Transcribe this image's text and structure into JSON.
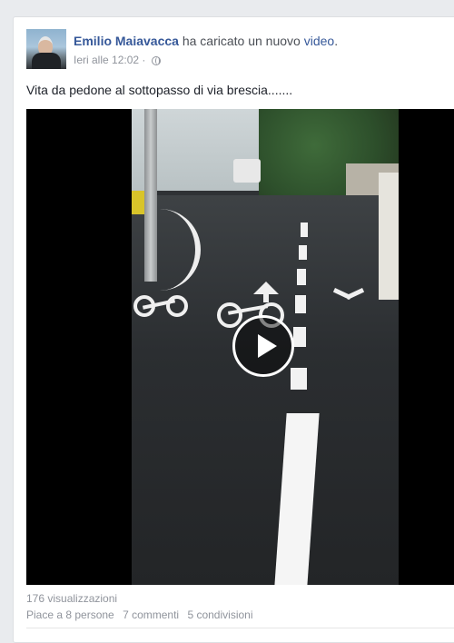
{
  "post": {
    "author": "Emilio Maiavacca",
    "action_text": "ha caricato un nuovo",
    "object_link": "video",
    "object_suffix": ".",
    "timestamp": "Ieri alle 12:02",
    "separator": "·",
    "privacy_icon": "globe-icon",
    "caption": "Vita da pedone al sottopasso di via brescia......."
  },
  "video": {
    "play_icon": "play-icon"
  },
  "stats": {
    "views": "176 visualizzazioni",
    "likes": "Piace a 8 persone",
    "comments": "7 commenti",
    "shares": "5 condivisioni"
  },
  "colors": {
    "link": "#365899",
    "meta": "#90949c",
    "text": "#1d2129"
  }
}
